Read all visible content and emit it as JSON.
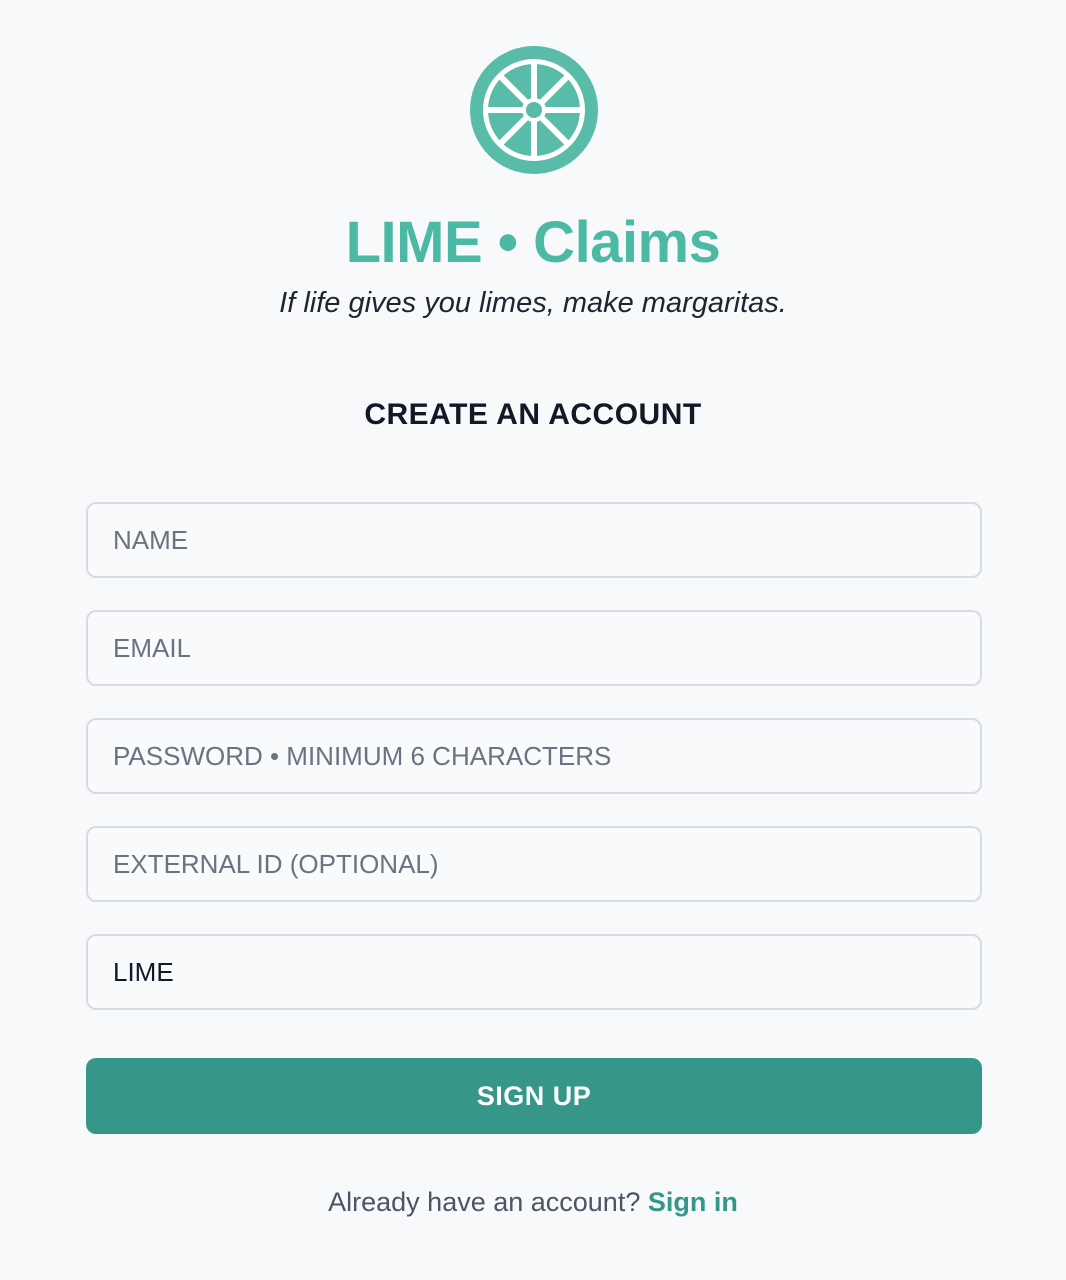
{
  "brand": {
    "title": "LIME • Claims",
    "tagline": "If life gives you limes, make margaritas.",
    "logo_icon": "lime-slice-icon",
    "accent_color": "#4cb9a4"
  },
  "form": {
    "heading": "CREATE AN ACCOUNT",
    "fields": {
      "name": {
        "placeholder": "NAME",
        "value": ""
      },
      "email": {
        "placeholder": "EMAIL",
        "value": ""
      },
      "password": {
        "placeholder": "PASSWORD • MINIMUM 6 CHARACTERS",
        "value": ""
      },
      "external_id": {
        "placeholder": "EXTERNAL ID (OPTIONAL)",
        "value": ""
      },
      "organization": {
        "placeholder": "",
        "value": "LIME"
      }
    },
    "submit_label": "SIGN UP",
    "button_color": "#36968a"
  },
  "footer": {
    "prompt": "Already have an account?",
    "link_label": "Sign in"
  }
}
